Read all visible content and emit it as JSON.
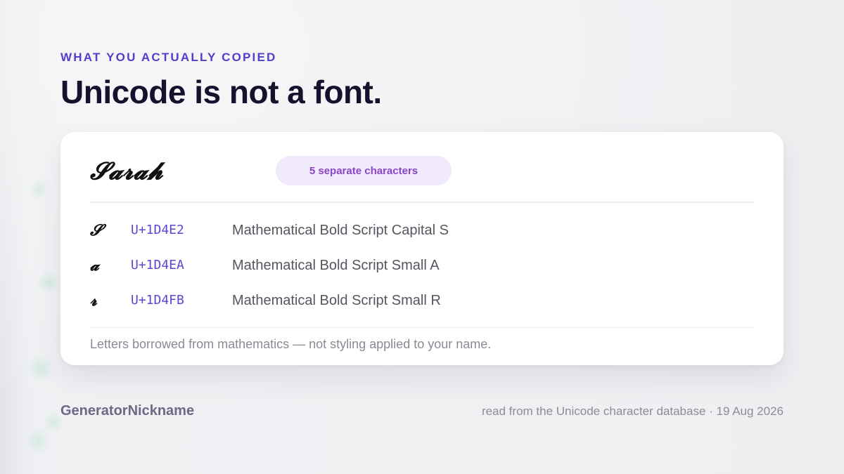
{
  "header": {
    "eyebrow": "WHAT YOU ACTUALLY COPIED",
    "title": "Unicode is not a font."
  },
  "card": {
    "name": "𝓢𝓪𝓻𝓪𝓱",
    "badge": "5 separate characters",
    "rows": [
      {
        "glyph": "𝓢",
        "code": "U+1D4E2",
        "description": "Mathematical Bold Script Capital S"
      },
      {
        "glyph": "𝓪",
        "code": "U+1D4EA",
        "description": "Mathematical Bold Script Small A"
      },
      {
        "glyph": "𝓻",
        "code": "U+1D4FB",
        "description": "Mathematical Bold Script Small R"
      }
    ],
    "footnote": "Letters borrowed from mathematics — not styling applied to your name."
  },
  "footer": {
    "brand": "GeneratorNickname",
    "source": "read from the Unicode character database · 19 Aug 2026"
  },
  "colors": {
    "accent": "#4f3fc9",
    "badge_bg": "#f1e9fc",
    "badge_text": "#8a44c6",
    "title": "#14122c"
  }
}
